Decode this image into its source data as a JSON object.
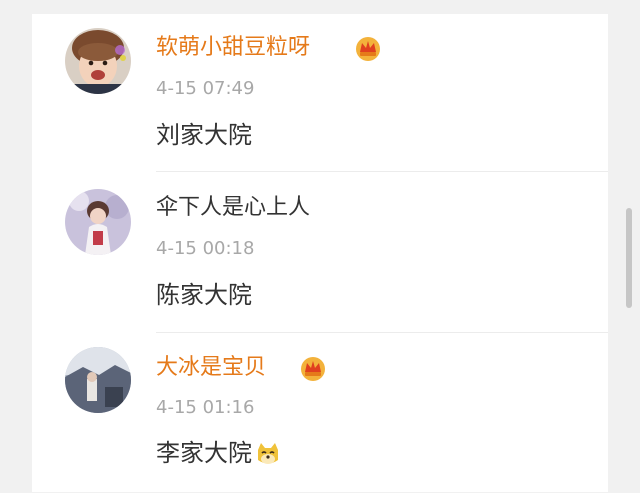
{
  "comments": [
    {
      "username": "软萌小甜豆粒呀",
      "username_color": "#e57a1a",
      "vip": true,
      "vip_icon": "crown-vip-icon",
      "time": "4-15 07:49",
      "text": "刘家大院",
      "avatar_icon": "baby-avatar"
    },
    {
      "username": "伞下人是心上人",
      "username_color": "#333333",
      "vip": false,
      "time": "4-15 00:18",
      "text": "陈家大院",
      "avatar_icon": "girl-avatar"
    },
    {
      "username": "大冰是宝贝",
      "username_color": "#e57a1a",
      "vip": true,
      "vip_icon": "crown-vip-icon",
      "time": "4-15 01:16",
      "text": "李家大院",
      "text_emoji": "doge-emoji",
      "avatar_icon": "photo-avatar"
    }
  ],
  "colors": {
    "page_bg": "#f1f1f1",
    "card_bg": "#ffffff",
    "vip_orange": "#e57a1a",
    "time_gray": "#a8a8a8"
  }
}
